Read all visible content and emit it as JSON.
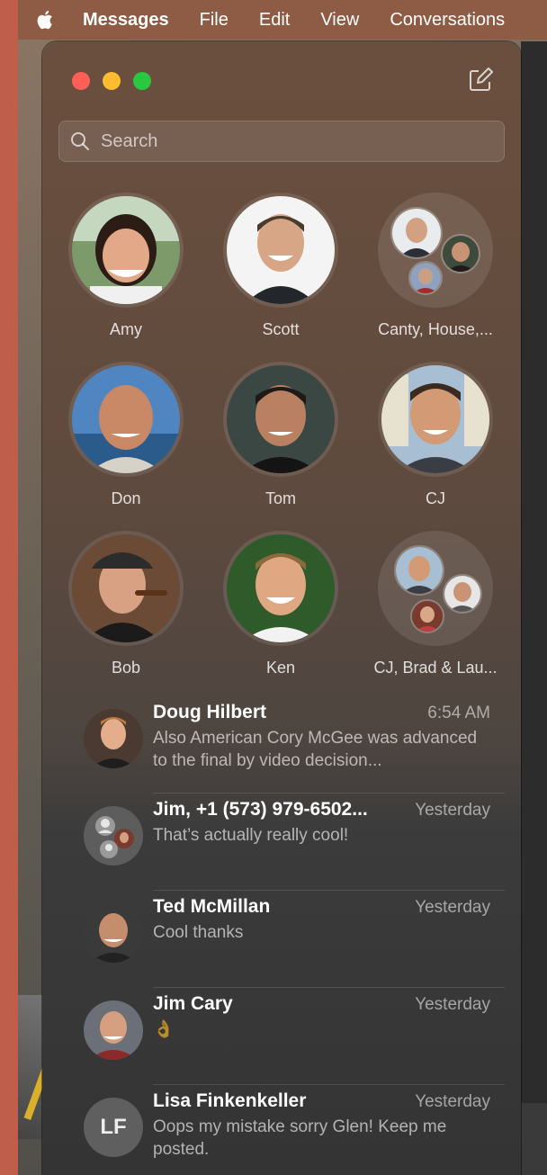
{
  "menubar": {
    "app": "Messages",
    "items": [
      "File",
      "Edit",
      "View",
      "Conversations"
    ]
  },
  "search": {
    "placeholder": "Search"
  },
  "pinned": [
    {
      "name": "Amy"
    },
    {
      "name": "Scott"
    },
    {
      "name": "Canty, House,..."
    },
    {
      "name": "Don"
    },
    {
      "name": "Tom"
    },
    {
      "name": "CJ"
    },
    {
      "name": "Bob"
    },
    {
      "name": "Ken"
    },
    {
      "name": "CJ, Brad & Lau..."
    }
  ],
  "conversations": [
    {
      "name": "Doug Hilbert",
      "time": "6:54 AM",
      "message": "Also American Cory McGee was advanced to the final by video decision..."
    },
    {
      "name": "Jim, +1 (573) 979-6502...",
      "time": "Yesterday",
      "message": "That’s actually really cool!"
    },
    {
      "name": "Ted McMillan",
      "time": "Yesterday",
      "message": "Cool thanks"
    },
    {
      "name": "Jim Cary",
      "time": "Yesterday",
      "message": "👌"
    },
    {
      "name": "Lisa Finkenkeller",
      "time": "Yesterday",
      "message": "Oops my mistake sorry Glen!  Keep me posted.",
      "initials": "LF"
    }
  ]
}
